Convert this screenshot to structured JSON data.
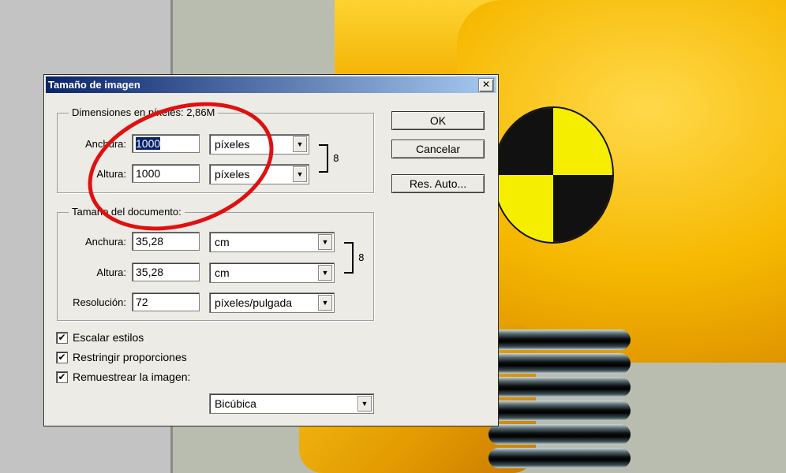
{
  "dialog": {
    "title": "Tamaño de imagen",
    "close_glyph": "✕",
    "pixel_dimensions": {
      "legend": "Dimensiones en píxeles: 2,86M",
      "width": {
        "label": "Anchura:",
        "value": "1000",
        "unit": "píxeles"
      },
      "height": {
        "label": "Altura:",
        "value": "1000",
        "unit": "píxeles"
      }
    },
    "document_size": {
      "legend": "Tamaño del documento:",
      "width": {
        "label": "Anchura:",
        "value": "35,28",
        "unit": "cm"
      },
      "height": {
        "label": "Altura:",
        "value": "35,28",
        "unit": "cm"
      },
      "resolution": {
        "label": "Resolución:",
        "value": "72",
        "unit": "píxeles/pulgada"
      }
    },
    "checkboxes": [
      {
        "label": "Escalar estilos",
        "checked": true
      },
      {
        "label": "Restringir proporciones",
        "checked": true
      },
      {
        "label": "Remuestrear la imagen:",
        "checked": true
      }
    ],
    "resample_method": "Bicúbica",
    "buttons": {
      "ok": "OK",
      "cancel": "Cancelar",
      "auto": "Res. Auto..."
    },
    "check_glyph": "✔",
    "arrow_glyph": "▼",
    "chain_glyph": "8"
  },
  "colors": {
    "title_bar_start": "#0a246a",
    "title_bar_end": "#a6caf0",
    "annotation_red": "#e01010"
  }
}
